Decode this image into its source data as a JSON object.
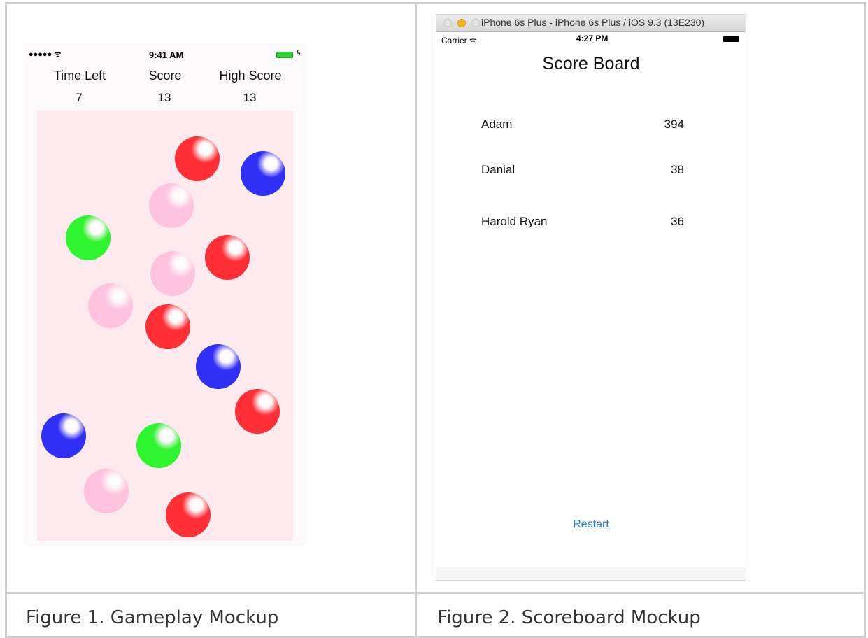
{
  "captions": {
    "figure1": "Figure 1. Gameplay Mockup",
    "figure2": "Figure 2. Scoreboard Mockup"
  },
  "gameplay": {
    "status": {
      "signal": "●●●●● ᯤ",
      "time": "9:41 AM"
    },
    "headers": {
      "time_left": "Time Left",
      "score": "Score",
      "high_score": "High Score"
    },
    "values": {
      "time_left": "7",
      "score": "13",
      "high_score": "13"
    },
    "ball_colors": {
      "red": "#ff2f35",
      "blue": "#2f2ff5",
      "green": "#2ff530",
      "pink": "#ffc3df"
    }
  },
  "scoreboard": {
    "window_title": "iPhone 6s Plus - iPhone 6s Plus / iOS 9.3 (13E230)",
    "status": {
      "carrier": "Carrier ᯤ",
      "time": "4:27 PM"
    },
    "title": "Score Board",
    "entries": [
      {
        "name": "Adam",
        "score": "394"
      },
      {
        "name": "Danial",
        "score": "38"
      },
      {
        "name": "Harold Ryan",
        "score": "36"
      }
    ],
    "restart_label": "Restart",
    "accent_color": "#1a7de0"
  }
}
